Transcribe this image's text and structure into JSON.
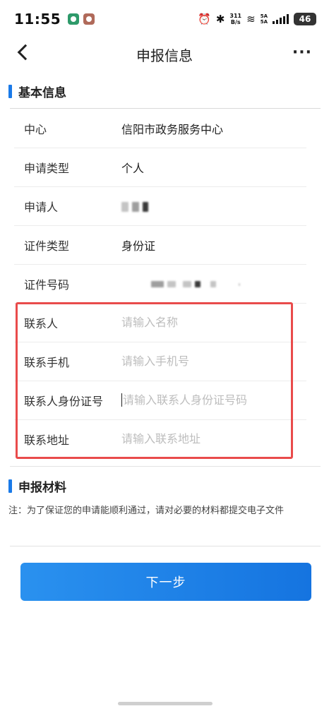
{
  "status_bar": {
    "time": "11:55",
    "net_speed_value": "311",
    "net_speed_unit": "B/s",
    "signal_top": "5A",
    "signal_bottom": "5A",
    "battery": "46"
  },
  "nav": {
    "title": "申报信息",
    "more": "···"
  },
  "basic_info": {
    "section_title": "基本信息",
    "rows": [
      {
        "label": "中心",
        "value": "信阳市政务服务中心"
      },
      {
        "label": "申请类型",
        "value": "个人"
      },
      {
        "label": "申请人",
        "value": ""
      },
      {
        "label": "证件类型",
        "value": "身份证"
      },
      {
        "label": "证件号码",
        "value": ""
      }
    ]
  },
  "contact": {
    "rows": [
      {
        "label": "联系人",
        "placeholder": "请输入名称"
      },
      {
        "label": "联系手机",
        "placeholder": "请输入手机号"
      },
      {
        "label": "联系人身份证号",
        "placeholder": "请输入联系人身份证号码"
      },
      {
        "label": "联系地址",
        "placeholder": "请输入联系地址"
      }
    ]
  },
  "materials": {
    "section_title": "申报材料",
    "note": "注：为了保证您的申请能顺利通过，请对必要的材料都提交电子文件"
  },
  "next_button": "下一步",
  "colors": {
    "accent": "#1a7ae8",
    "highlight_border": "#e94b4b",
    "button": "#1f84ea",
    "placeholder": "#bdbdbd"
  }
}
